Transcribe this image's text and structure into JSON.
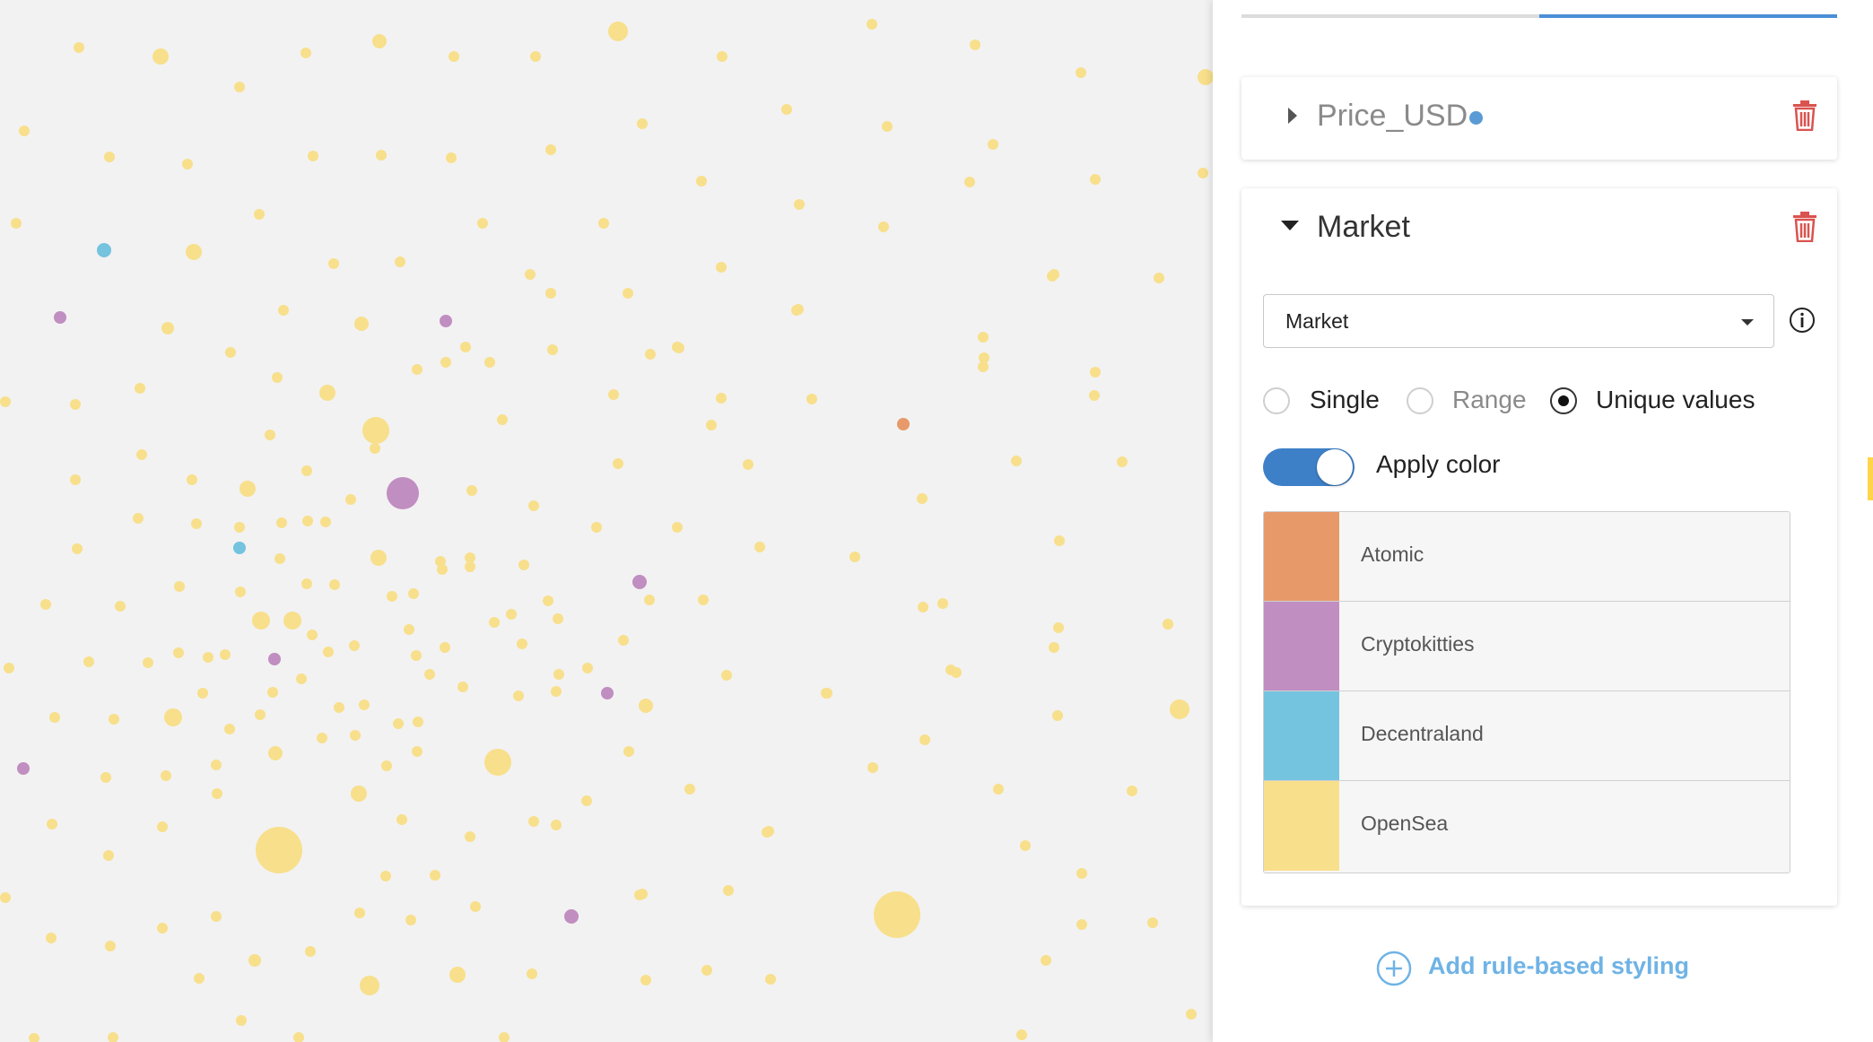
{
  "map": {
    "legend_colors": {
      "Atomic": "#e8996a",
      "Cryptokitties": "#c08ec0",
      "Decentraland": "#74c3df",
      "OpenSea": "#f8df8b"
    }
  },
  "panel": {
    "rules": [
      {
        "name": "Price_USD",
        "expanded": false,
        "indicator_color": "#5b9bd5"
      },
      {
        "name": "Market",
        "expanded": true
      }
    ],
    "market": {
      "field_select_value": "Market",
      "modes": [
        {
          "label": "Single",
          "selected": false
        },
        {
          "label": "Range",
          "selected": false
        },
        {
          "label": "Unique values",
          "selected": true
        }
      ],
      "apply_color_label": "Apply color",
      "apply_color_on": true,
      "legend": [
        {
          "label": "Atomic",
          "color": "#e8996a"
        },
        {
          "label": "Cryptokitties",
          "color": "#c08ec0"
        },
        {
          "label": "Decentraland",
          "color": "#74c3df"
        },
        {
          "label": "OpenSea",
          "color": "#f8df8b"
        }
      ]
    },
    "add_rule_label": "Add rule-based styling",
    "accent_color": "#4a8fd6",
    "delete_color": "#d9534f"
  }
}
